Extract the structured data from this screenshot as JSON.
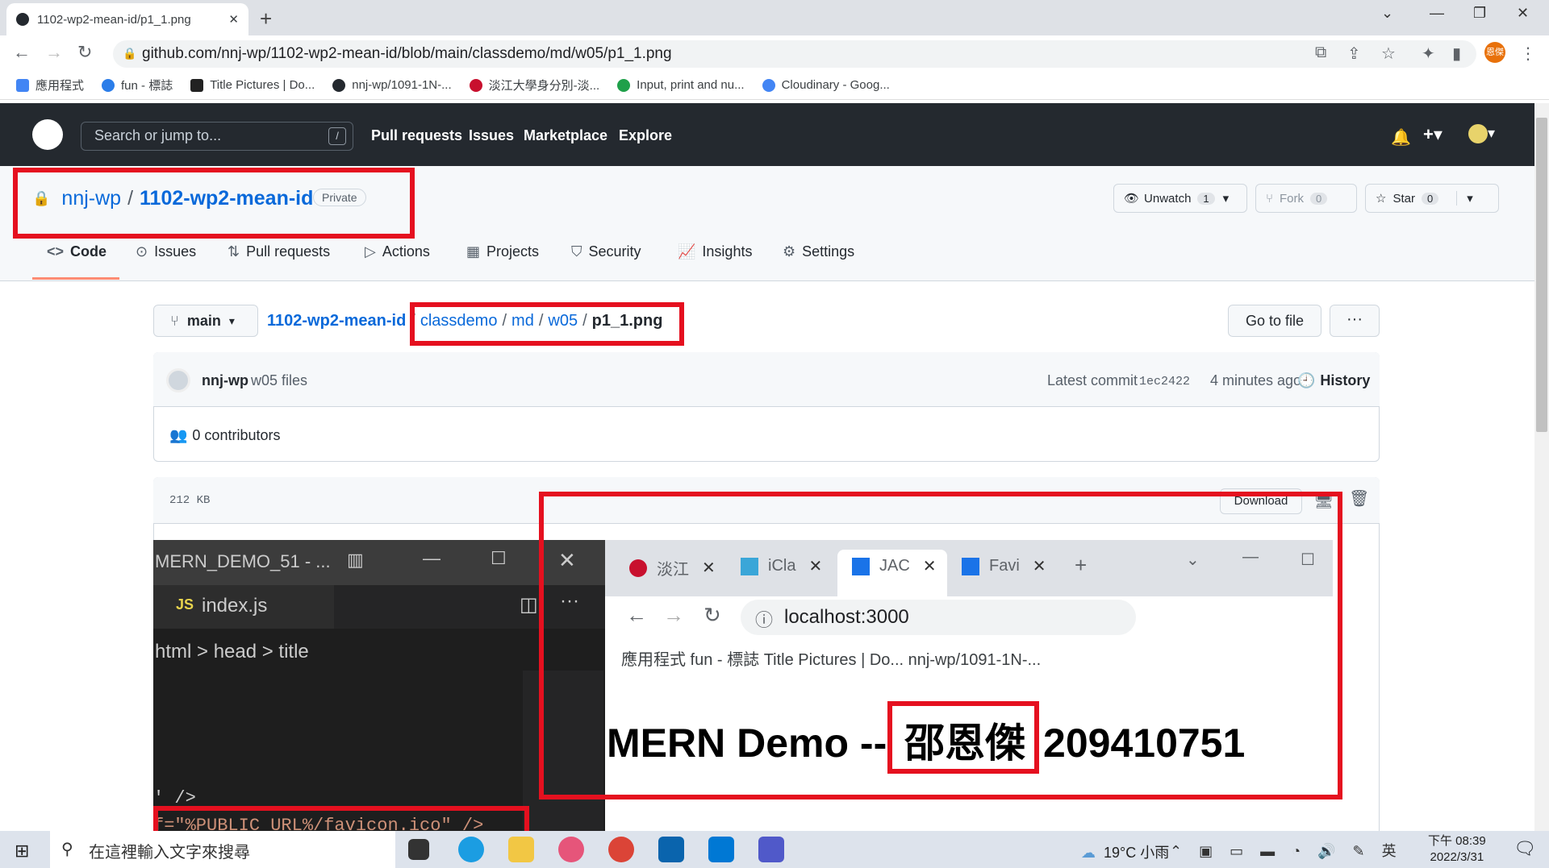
{
  "browser": {
    "tab_title": "1102-wp2-mean-id/p1_1.png",
    "url": "github.com/nnj-wp/1102-wp2-mean-id/blob/main/classdemo/md/w05/p1_1.png",
    "profile_initials": "恩傑",
    "bookmarks": [
      {
        "label": "應用程式",
        "color": "#4285f4"
      },
      {
        "label": "fun - 標誌",
        "color": "#2b7de9"
      },
      {
        "label": "Title Pictures | Do...",
        "color": "#222222"
      },
      {
        "label": "nnj-wp/1091-1N-...",
        "color": "#24292f"
      },
      {
        "label": "淡江大學身分別-淡...",
        "color": "#c8102e"
      },
      {
        "label": "Input, print and nu...",
        "color": "#1fa04a"
      },
      {
        "label": "Cloudinary - Goog...",
        "color": "#4285f4"
      }
    ]
  },
  "github": {
    "search_placeholder": "Search or jump to...",
    "search_shortcut": "/",
    "nav": [
      "Pull requests",
      "Issues",
      "Marketplace",
      "Explore"
    ],
    "repo_owner": "nnj-wp",
    "repo_sep": "/",
    "repo_name": "1102-wp2-mean-id",
    "visibility": "Private",
    "unwatch_label": "Unwatch",
    "unwatch_count": "1",
    "fork_label": "Fork",
    "fork_count": "0",
    "star_label": "Star",
    "star_count": "0",
    "tabs": [
      "Code",
      "Issues",
      "Pull requests",
      "Actions",
      "Projects",
      "Security",
      "Insights",
      "Settings"
    ],
    "branch": "main",
    "breadcrumb": {
      "root": "1102-wp2-mean-id",
      "dirs": [
        "classdemo",
        "md",
        "w05"
      ],
      "sep": "/",
      "file": "p1_1.png"
    },
    "go_to_file": "Go to file",
    "more": "···",
    "commit": {
      "author": "nnj-wp",
      "message": "w05 files",
      "latest_label": "Latest commit",
      "sha": "1ec2422",
      "ago": "4 minutes ago",
      "history": "History"
    },
    "contributors": "0 contributors",
    "file_size": "212 KB",
    "download": "Download"
  },
  "embedded": {
    "vscode_title": "MERN_DEMO_51 - ...",
    "vscode_tab": "index.js",
    "vscode_tab_prefix": "JS",
    "vscode_crumb": "html > head > title",
    "code_line1": "' />",
    "code_line2": "f=\"%PUBLIC_URL%/favicon.ico\" />",
    "browser_tabs": [
      "淡江",
      "iCla",
      "JAC",
      "Favi"
    ],
    "browser_url": "localhost:3000",
    "browser_bookmarks": "應用程式    fun - 標誌    Title Pictures | Do...    nnj-wp/1091-1N-...",
    "heading_prefix": "MERN Demo --",
    "heading_name": "邵恩傑",
    "heading_id": "209410751"
  },
  "taskbar": {
    "search_placeholder": "在這裡輸入文字來搜尋",
    "weather": "19°C 小雨",
    "ime": "英",
    "time_period": "下午 08:39",
    "date": "2022/3/31"
  },
  "colors": {
    "annotation_red": "#e5101f",
    "gh_header": "#24292f",
    "link_blue": "#0969da"
  }
}
